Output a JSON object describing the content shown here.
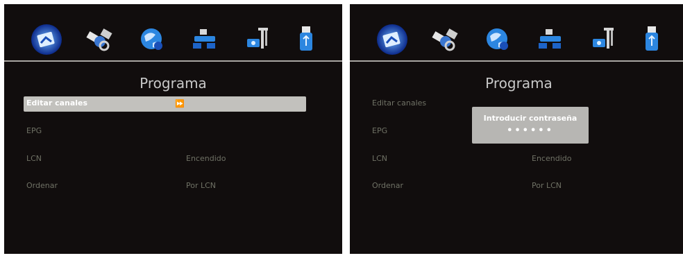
{
  "screens": [
    {
      "title": "Programa",
      "rows": [
        {
          "label": "Editar canales",
          "value": "",
          "selected": true
        },
        {
          "label": "EPG",
          "value": ""
        },
        {
          "label": "LCN",
          "value": "Encendido"
        },
        {
          "label": "Ordenar",
          "value": "Por LCN"
        }
      ],
      "arrow": "⏩"
    },
    {
      "title": "Programa",
      "rows": [
        {
          "label": "Editar canales",
          "value": ""
        },
        {
          "label": "EPG",
          "value": ""
        },
        {
          "label": "LCN",
          "value": "Encendido"
        },
        {
          "label": "Ordenar",
          "value": "Por LCN"
        }
      ],
      "dialog": {
        "title": "Introducir contraseña",
        "password": "••••••"
      }
    }
  ],
  "menu_icons": [
    "program-icon",
    "satellite-icon",
    "globe-icon",
    "network-icon",
    "settings-tools-icon",
    "usb-icon"
  ],
  "colors": {
    "screen_bg": "#110d0d",
    "accent": "#2f7fd8",
    "selected_row": "#c2c1bd",
    "text_dim": "#6f7165"
  }
}
